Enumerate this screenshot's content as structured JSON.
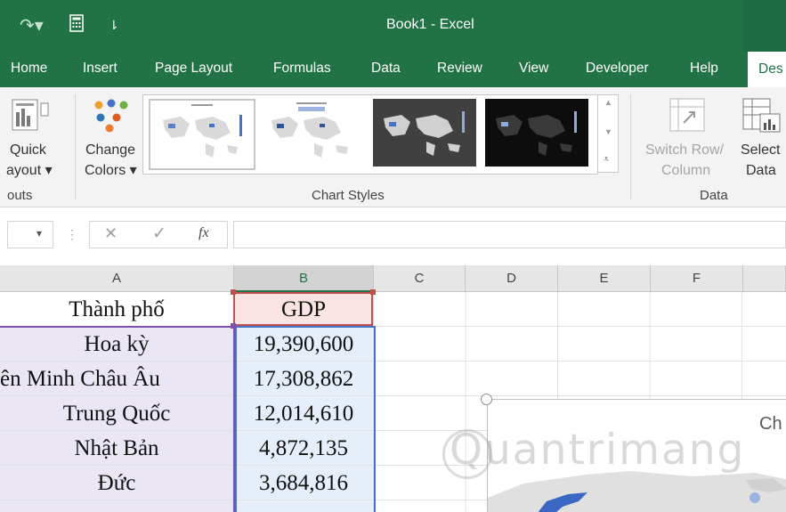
{
  "window": {
    "title": "Book1  -  Excel"
  },
  "tabs": [
    "Home",
    "Insert",
    "Page Layout",
    "Formulas",
    "Data",
    "Review",
    "View",
    "Developer",
    "Help",
    "Des"
  ],
  "ribbon": {
    "quick_layout": {
      "line1": "Quick",
      "line2": "ayout ▾"
    },
    "change_colors": {
      "line1": "Change",
      "line2": "Colors ▾"
    },
    "switch_row": {
      "line1": "Switch Row/",
      "line2": "Column"
    },
    "select_data": {
      "line1": "Select",
      "line2": "Data"
    },
    "groups": {
      "layouts": "outs",
      "styles": "Chart Styles",
      "data": "Data"
    }
  },
  "formula_bar": {
    "fx": "fx",
    "cancel": "✕",
    "enter": "✓",
    "name_dropdown": "▾"
  },
  "columns": [
    "A",
    "B",
    "C",
    "D",
    "E",
    "F"
  ],
  "table": {
    "header": {
      "city": "Thành phố",
      "gdp": "GDP"
    },
    "rows": [
      {
        "city": "Hoa kỳ",
        "gdp": "19,390,600"
      },
      {
        "city": "ên Minh Châu Âu",
        "gdp": "17,308,862"
      },
      {
        "city": "Trung Quốc",
        "gdp": "12,014,610"
      },
      {
        "city": "Nhật Bản",
        "gdp": "4,872,135"
      },
      {
        "city": "Đức",
        "gdp": "3,684,816"
      },
      {
        "city": "",
        "gdp": ""
      }
    ]
  },
  "chart": {
    "title_partial": "Ch"
  },
  "watermark": "Quantrimang",
  "colors": {
    "excel_green": "#217346",
    "col_a_fill": "#ebe6f4",
    "col_b_fill": "#e5eef9"
  }
}
